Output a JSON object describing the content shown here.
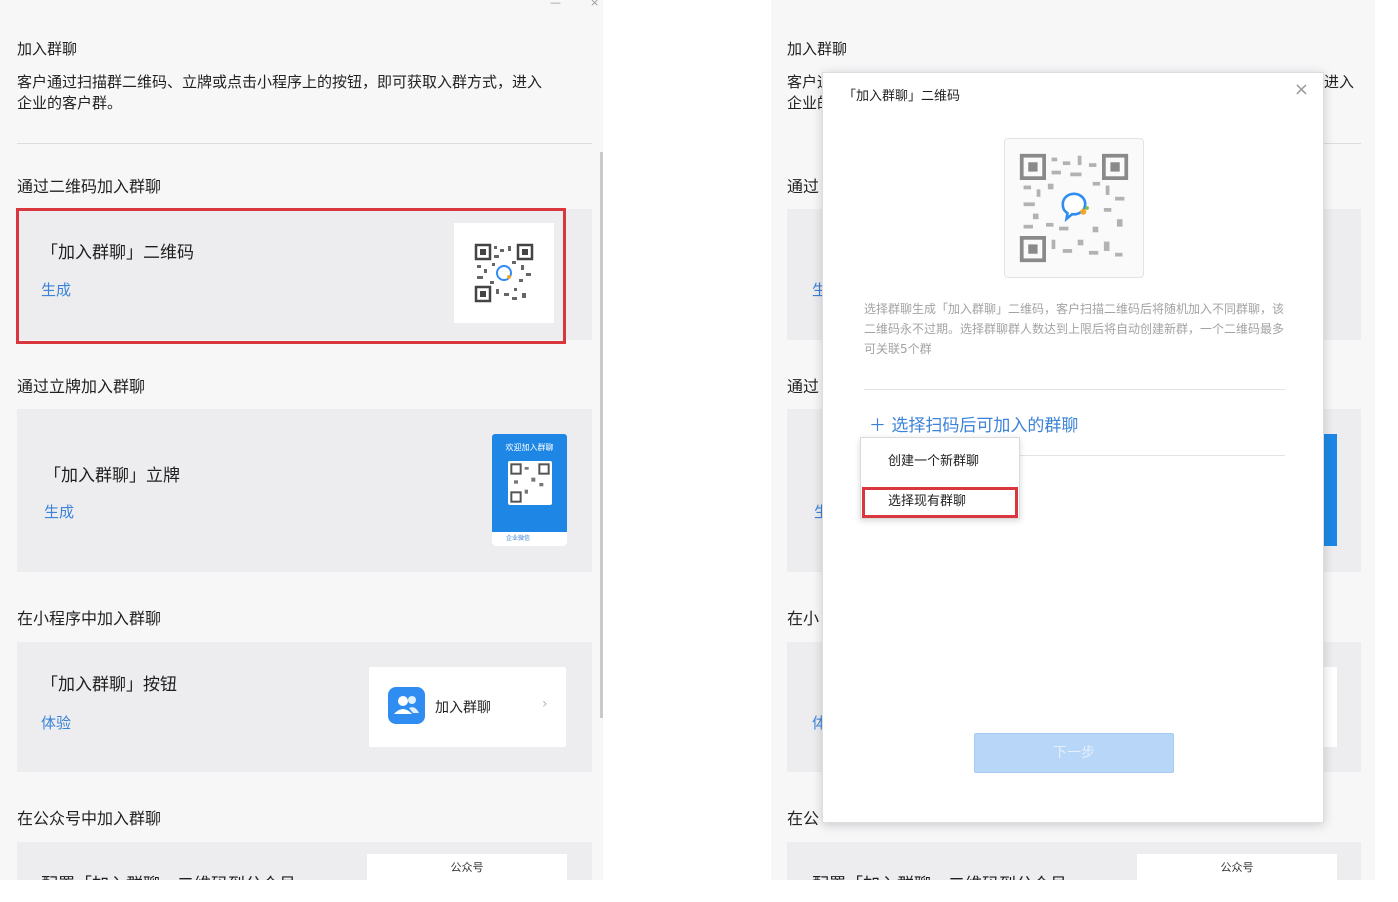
{
  "colors": {
    "accent": "#3b83d8",
    "highlight": "#d9363e",
    "poster_blue": "#1e87e6",
    "disabled_button": "#b7d6f8"
  },
  "window_controls": {
    "minimize": "—",
    "close": "×"
  },
  "left": {
    "heading": "加入群聊",
    "description_line1": "客户通过扫描群二维码、立牌或点击小程序上的按钮，即可获取入群方式，进入",
    "description_line2": "企业的客户群。",
    "sections": {
      "qrcode": {
        "title": "通过二维码加入群聊",
        "card_title": "「加入群聊」二维码",
        "link": "生成"
      },
      "stand": {
        "title": "通过立牌加入群聊",
        "card_title": "「加入群聊」立牌",
        "link": "生成",
        "poster_title": "欢迎加入群聊",
        "poster_footer": "企业微信"
      },
      "miniprogram": {
        "title": "在小程序中加入群聊",
        "card_title": "「加入群聊」按钮",
        "link": "体验",
        "button_label": "加入群聊",
        "chevron": "›"
      },
      "official": {
        "title": "在公众号中加入群聊",
        "card_title": "配置「加入群聊」二维码到公众号",
        "tag": "公众号"
      }
    }
  },
  "right": {
    "heading": "加入群聊",
    "desc_fragment_a": "客户通",
    "desc_fragment_b": "企业的",
    "desc_fragment_c": "进入",
    "sec_fragment_a": "通过",
    "sec_fragment_b": "通过",
    "sec_fragment_c": "在小",
    "sec_fragment_d": "在公",
    "card_frag_a": "「",
    "card_frag_b": "生",
    "card_frag_c": "「",
    "card_frag_d": "生",
    "card_frag_e": "「",
    "card_frag_f": "体",
    "official_card_title": "配置「加入群聊」二维码到公众号",
    "official_tag": "公众号"
  },
  "modal": {
    "title": "「加入群聊」二维码",
    "close": "×",
    "description": "选择群聊生成「加入群聊」二维码，客户扫描二维码后将随机加入不同群聊，该二维码永不过期。选择群聊群人数达到上限后将自动创建新群，一个二维码最多可关联5个群",
    "add_link": "＋  选择扫码后可加入的群聊",
    "dropdown": [
      "创建一个新群聊",
      "选择现有群聊"
    ],
    "next_button": "下一步"
  }
}
